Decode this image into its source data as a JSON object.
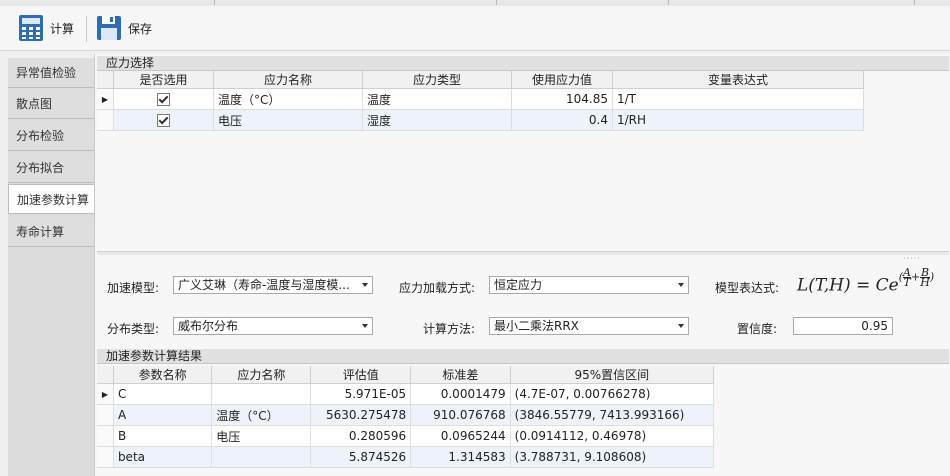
{
  "toolbar": {
    "calc_label": "计算",
    "save_label": "保存"
  },
  "nav": {
    "items": [
      {
        "label": "异常值检验"
      },
      {
        "label": "散点图"
      },
      {
        "label": "分布检验"
      },
      {
        "label": "分布拟合"
      },
      {
        "label": "加速参数计算",
        "active": true
      },
      {
        "label": "寿命计算"
      }
    ]
  },
  "stress": {
    "title": "应力选择",
    "columns": [
      "是否选用",
      "应力名称",
      "应力类型",
      "使用应力值",
      "变量表达式"
    ],
    "rows": [
      {
        "selected": true,
        "name": "温度（°C）",
        "type": "温度",
        "value": "104.85",
        "expr": "1/T"
      },
      {
        "selected": true,
        "name": "电压",
        "type": "湿度",
        "value": "0.4",
        "expr": "1/RH"
      }
    ]
  },
  "form": {
    "model_label": "加速模型:",
    "model_value": "广义艾琳（寿命-温度与湿度模...",
    "load_label": "应力加载方式:",
    "load_value": "恒定应力",
    "expr_label": "模型表达式:",
    "dist_label": "分布类型:",
    "dist_value": "威布尔分布",
    "method_label": "计算方法:",
    "method_value": "最小二乘法RRX",
    "conf_label": "置信度:",
    "conf_value": "0.95"
  },
  "formula": {
    "lhs": "L(T,H) = Ce",
    "num_a": "A",
    "den_t": "T",
    "plus": "+",
    "num_b": "B",
    "den_h": "H"
  },
  "results": {
    "title": "加速参数计算结果",
    "columns": [
      "参数名称",
      "应力名称",
      "评估值",
      "标准差",
      "95%置信区间"
    ],
    "rows": [
      {
        "param": "C",
        "stress": "",
        "est": "5.971E-05",
        "std": "0.0001479",
        "ci": "(4.7E-07, 0.00766278)"
      },
      {
        "param": "A",
        "stress": "温度（°C）",
        "est": "5630.275478",
        "std": "910.076768",
        "ci": "(3846.55779, 7413.993166)"
      },
      {
        "param": "B",
        "stress": "电压",
        "est": "0.280596",
        "std": "0.0965244",
        "ci": "(0.0914112, 0.46978)"
      },
      {
        "param": "beta",
        "stress": "",
        "est": "5.874526",
        "std": "1.314583",
        "ci": "(3.788731, 9.108608)"
      }
    ]
  },
  "colors": {
    "alt_row": "#eef2fa",
    "header_bg": "#e1e1e1",
    "icon_blue": "#2e6db4"
  }
}
